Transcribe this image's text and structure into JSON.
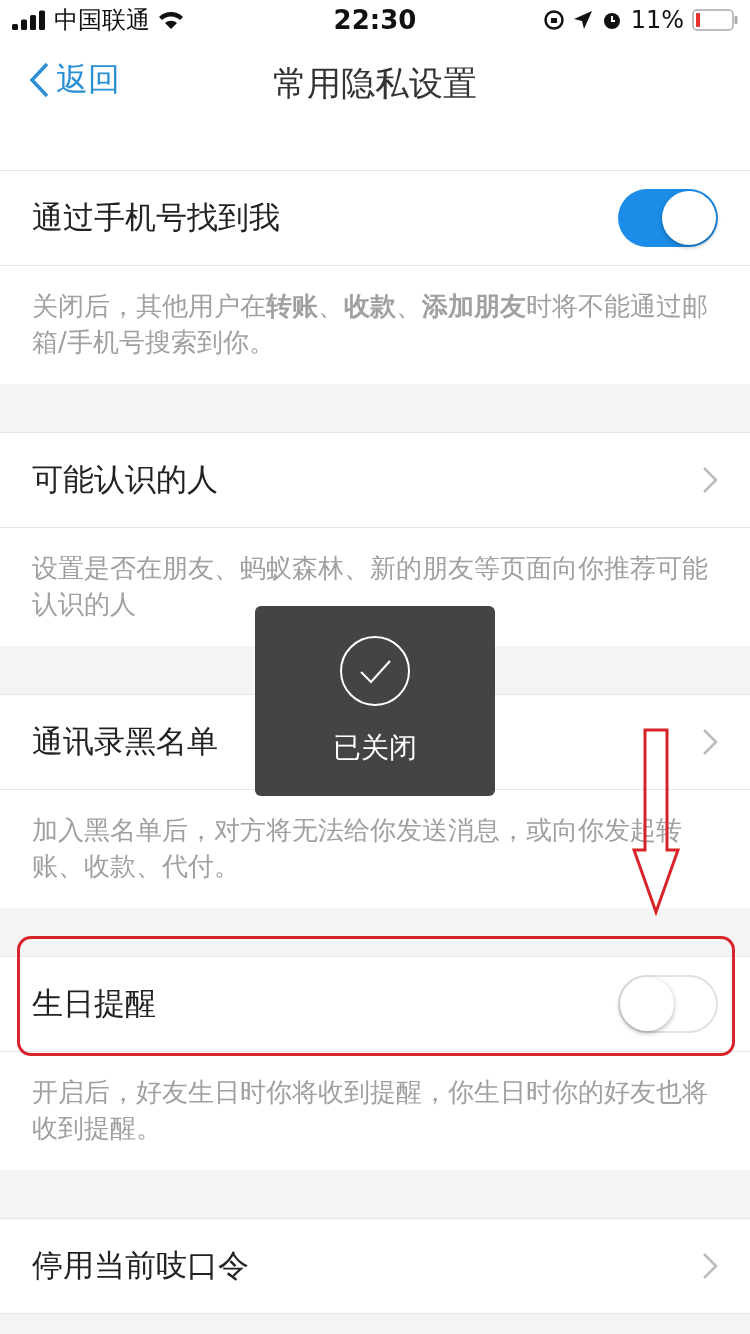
{
  "status_bar": {
    "carrier": "中国联通",
    "time": "22:30",
    "battery": "11%"
  },
  "nav": {
    "back": "返回",
    "title": "常用隐私设置"
  },
  "sections": [
    {
      "kind": "toggle",
      "title": "通过手机号找到我",
      "on": true,
      "description": "关闭后，其他用户在**转账**、**收款**、**添加朋友**时将不能通过邮箱/手机号搜索到你。"
    },
    {
      "kind": "link",
      "title": "可能认识的人",
      "description": "设置是否在朋友、蚂蚁森林、新的朋友等页面向你推荐可能认识的人"
    },
    {
      "kind": "link",
      "title": "通讯录黑名单",
      "description": "加入黑名单后，对方将无法给你发送消息，或向你发起转账、收款、代付。"
    },
    {
      "kind": "toggle",
      "title": "生日提醒",
      "on": false,
      "description": "开启后，好友生日时你将收到提醒，你生日时你的好友也将收到提醒。"
    },
    {
      "kind": "link",
      "title": "停用当前吱口令"
    }
  ],
  "toast": {
    "text": "已关闭"
  }
}
